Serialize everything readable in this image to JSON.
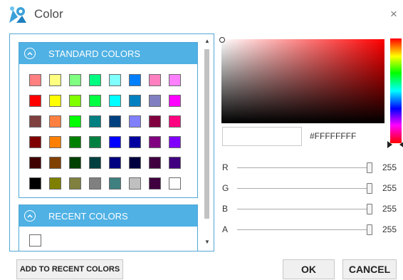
{
  "window": {
    "title": "Color",
    "close_glyph": "×",
    "icon": "color-app-icon",
    "accent": "#4fb1e4"
  },
  "standard": {
    "label": "STANDARD COLORS",
    "colors": [
      "#ff8080",
      "#ffff80",
      "#80ff80",
      "#00ff80",
      "#80ffff",
      "#0080ff",
      "#ff80c0",
      "#ff80ff",
      "#ff0000",
      "#ffff00",
      "#80ff00",
      "#00ff40",
      "#00ffff",
      "#0080c0",
      "#8080c0",
      "#ff00ff",
      "#804040",
      "#ff8040",
      "#00ff00",
      "#008080",
      "#004080",
      "#8080ff",
      "#800040",
      "#ff0080",
      "#800000",
      "#ff8000",
      "#008000",
      "#008040",
      "#0000ff",
      "#0000a0",
      "#800080",
      "#8000ff",
      "#400000",
      "#804000",
      "#004000",
      "#004040",
      "#000080",
      "#000040",
      "#400040",
      "#400080",
      "#000000",
      "#808000",
      "#808040",
      "#808080",
      "#408080",
      "#c0c0c0",
      "#400040",
      "#ffffff"
    ]
  },
  "recent": {
    "label": "RECENT COLORS",
    "colors": [
      "#ffffff"
    ]
  },
  "picker": {
    "hex_value": "#FFFFFFFF",
    "preview_color": "#ffffff",
    "sliders": [
      {
        "label": "R",
        "value": "255",
        "fraction": 1
      },
      {
        "label": "G",
        "value": "255",
        "fraction": 1
      },
      {
        "label": "B",
        "value": "255",
        "fraction": 1
      },
      {
        "label": "A",
        "value": "255",
        "fraction": 1
      }
    ]
  },
  "buttons": {
    "add_recent": "ADD TO RECENT COLORS",
    "ok": "OK",
    "cancel": "CANCEL"
  },
  "icons": {
    "chevron": "chevron-up-icon",
    "scroll_up": "▲",
    "scroll_down": "▼"
  }
}
